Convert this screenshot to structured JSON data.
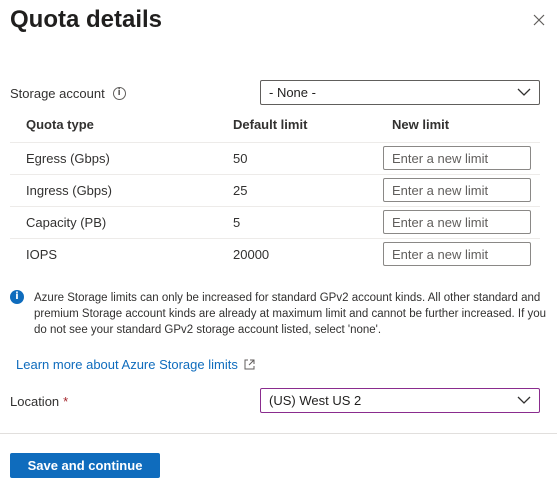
{
  "header": {
    "title": "Quota details",
    "close_icon": "close-icon"
  },
  "storage_account": {
    "label": "Storage account",
    "info_icon": "info-icon",
    "selected": "- None -"
  },
  "table": {
    "headers": [
      "Quota type",
      "Default limit",
      "New limit"
    ],
    "rows": [
      {
        "type": "Egress (Gbps)",
        "default": "50",
        "placeholder": "Enter a new limit"
      },
      {
        "type": "Ingress (Gbps)",
        "default": "25",
        "placeholder": "Enter a new limit"
      },
      {
        "type": "Capacity (PB)",
        "default": "5",
        "placeholder": "Enter a new limit"
      },
      {
        "type": "IOPS",
        "default": "20000",
        "placeholder": "Enter a new limit"
      }
    ]
  },
  "info_message": "Azure Storage limits can only be increased for standard GPv2 account kinds. All other standard and premium Storage account kinds are already at maximum limit and cannot be further increased. If you do not see your standard GPv2 storage account listed, select 'none'.",
  "learn_more": {
    "text": "Learn more about Azure Storage limits",
    "icon": "external-link-icon"
  },
  "location": {
    "label": "Location",
    "required_marker": "*",
    "selected": "(US) West US 2"
  },
  "footer": {
    "primary_button": "Save and continue"
  },
  "colors": {
    "accent": "#0f6cbd",
    "focus_border": "#8a2c8e",
    "required": "#a4262c"
  }
}
